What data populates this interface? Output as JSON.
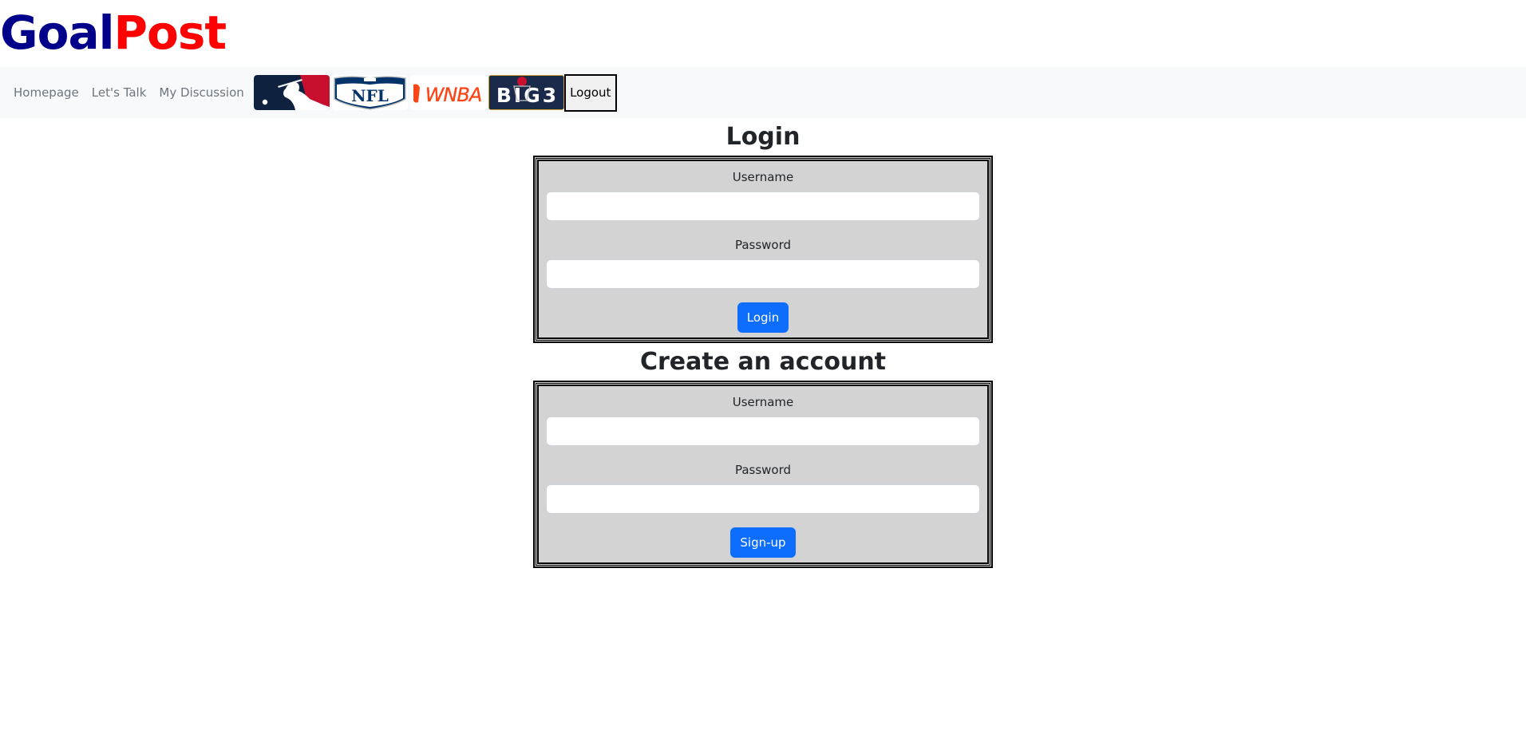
{
  "brand": {
    "part1": "Goal",
    "part2": "Post",
    "color1": "#00008b",
    "color2": "#ff0000"
  },
  "nav": {
    "links": [
      "Homepage",
      "Let's Talk",
      "My Discussion"
    ],
    "logos": [
      "mlb-logo",
      "nfl-logo",
      "wnba-logo",
      "big3-logo"
    ],
    "logo_texts": {
      "nfl": "NFL",
      "wnba": "WNBA",
      "big3": "BIG3"
    },
    "logout_label": "Logout"
  },
  "login": {
    "title": "Login",
    "username_label": "Username",
    "username_value": "",
    "password_label": "Password",
    "password_value": "",
    "button_label": "Login"
  },
  "signup": {
    "title": "Create an account",
    "username_label": "Username",
    "username_value": "",
    "password_label": "Password",
    "password_value": "",
    "button_label": "Sign-up"
  },
  "colors": {
    "primary": "#0d6efd",
    "form_bg": "#d3d3d3",
    "navbar_bg": "#f8f9fa"
  }
}
